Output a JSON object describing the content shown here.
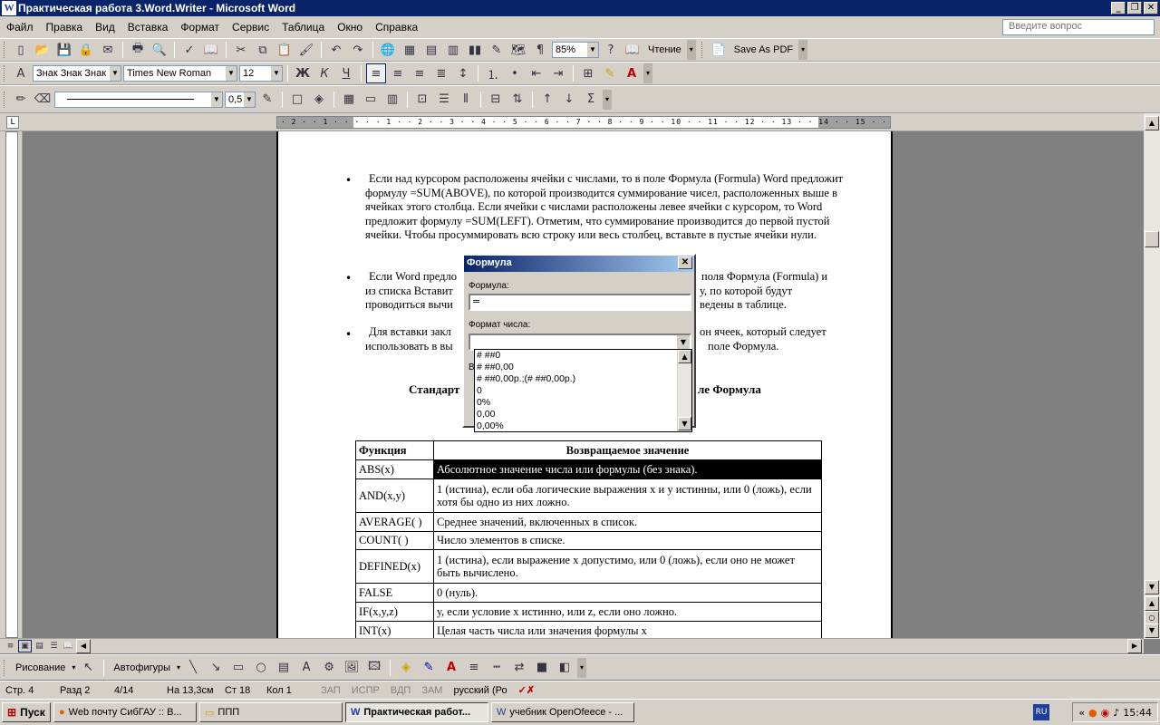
{
  "window": {
    "title": "Практическая работа 3.Word.Writer - Microsoft Word",
    "app_icon": "W"
  },
  "menu": {
    "items": [
      "Файл",
      "Правка",
      "Вид",
      "Вставка",
      "Формат",
      "Сервис",
      "Таблица",
      "Окно",
      "Справка"
    ],
    "ask_placeholder": "Введите вопрос"
  },
  "toolbar": {
    "zoom": "85%",
    "read_label": "Чтение",
    "save_pdf_label": "Save As PDF",
    "style": "Знак Знак Знак",
    "font": "Times New Roman",
    "size": "12",
    "line_weight": "0,5"
  },
  "ruler": {
    "text": "· 2 · · 1 · · · · · 1 · · 2 · · 3 · · 4 · · 5 · · 6 · · 7 · · 8 · · 9 · · 10 · · 11 · · 12 · · 13 · · 14 · · 15 · · 16 · · 17 · · 18"
  },
  "document": {
    "para1": "Если над курсором расположены ячейки с числами, то в поле Формула (Formula) Word предложит формулу =SUM(ABOVE), по которой производится суммирование чисел, расположенных выше в ячейках этого столбца. Если ячейки с числами расположены левее ячейки с курсором, то Word предложит формулу =SUM(LEFT). Отметим, что суммирование производится до первой пустой ячейки. Чтобы просуммировать всю строку или весь столбец, вставьте в пустые ячейки нули.",
    "para2_a": "Если Word предло",
    "para2_b": "поля Формула (Formula) и",
    "para2_c": "из списка Вставит",
    "para2_d": "у, по которой будут",
    "para2_e": "проводиться вычи",
    "para2_f": "ведены в таблице.",
    "para3_a": "Для вставки закл",
    "para3_b": "он ячеек, который следует",
    "para3_c": "использовать в вы",
    "para3_d": "поле Формула.",
    "title_a": "Стандарт",
    "title_b": "ле Формула",
    "table": {
      "headers": [
        "Функция",
        "Возвращаемое значение"
      ],
      "rows": [
        [
          "ABS(x)",
          "Абсолютное значение числа или формулы (без знака)."
        ],
        [
          "AND(x,y)",
          "1 (истина), если оба логические выражения x и y истинны, или 0 (ложь), если хотя бы одно из них ложно."
        ],
        [
          "AVERAGE( )",
          "Среднее значений, включенных в список."
        ],
        [
          "COUNT( )",
          "Число элементов в списке."
        ],
        [
          "DEFINED(x)",
          "1 (истина), если выражение x допустимо, или 0 (ложь), если оно не может быть вычислено."
        ],
        [
          "FALSE",
          "0 (нуль)."
        ],
        [
          "IF(x,y,z)",
          "у, если условие х истинно, или z, если оно ложно."
        ],
        [
          "INT(x)",
          "Целая часть числа или значения формулы х"
        ]
      ]
    }
  },
  "dialog": {
    "title": "Формула",
    "formula_label": "Формула:",
    "formula_value": "=",
    "format_label": "Формат числа:",
    "format_value": "",
    "options": [
      "# ##0",
      "# ##0,00",
      "# ##0,00р.;(# ##0,00р.)",
      "0",
      "0%",
      "0,00",
      "0,00%"
    ],
    "hidden_label": "В"
  },
  "status": {
    "page": "Стр. 4",
    "section": "Разд 2",
    "pages": "4/14",
    "at": "На 13,3см",
    "line": "Ст 18",
    "col": "Кол 1",
    "rec": "ЗАП",
    "trk": "ИСПР",
    "ext": "ВДП",
    "ovr": "ЗАМ",
    "lang": "русский (Ро"
  },
  "drawing": {
    "draw_label": "Рисование",
    "autoshapes_label": "Автофигуры"
  },
  "taskbar": {
    "start": "Пуск",
    "tasks": [
      "Web почту СибГАУ :: В...",
      "ППП",
      "Практическая работ...",
      "учебник OpenOfeece - ..."
    ],
    "lang": "RU",
    "clock": "15:44"
  }
}
